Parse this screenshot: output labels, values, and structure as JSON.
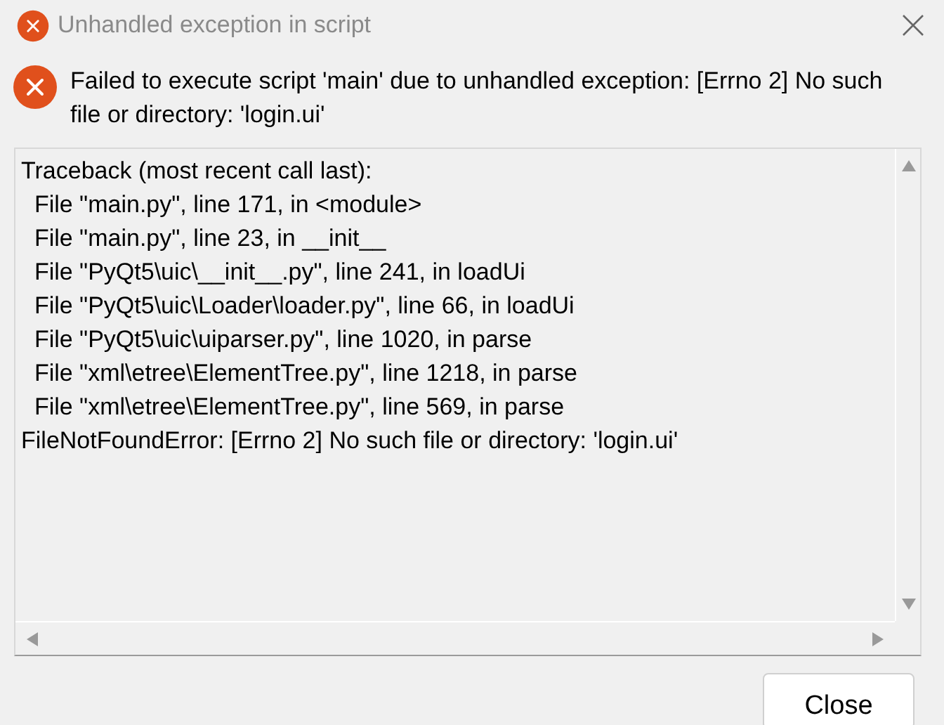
{
  "window": {
    "title": "Unhandled exception in script"
  },
  "message": "Failed to execute script 'main' due to unhandled exception: [Errno 2] No such file or directory: 'login.ui'",
  "traceback": [
    "Traceback (most recent call last):",
    "  File \"main.py\", line 171, in <module>",
    "  File \"main.py\", line 23, in __init__",
    "  File \"PyQt5\\uic\\__init__.py\", line 241, in loadUi",
    "  File \"PyQt5\\uic\\Loader\\loader.py\", line 66, in loadUi",
    "  File \"PyQt5\\uic\\uiparser.py\", line 1020, in parse",
    "  File \"xml\\etree\\ElementTree.py\", line 1218, in parse",
    "  File \"xml\\etree\\ElementTree.py\", line 569, in parse",
    "FileNotFoundError: [Errno 2] No such file or directory: 'login.ui'"
  ],
  "buttons": [
    "Close"
  ]
}
